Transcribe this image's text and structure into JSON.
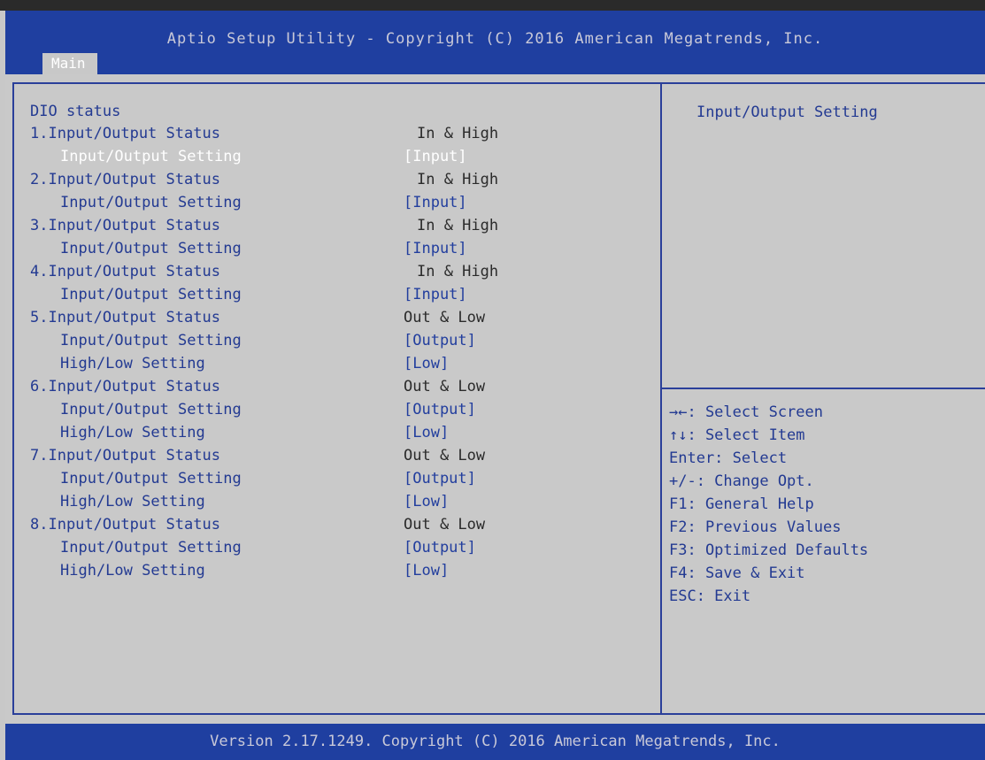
{
  "header": {
    "title": "Aptio Setup Utility - Copyright (C) 2016 American Megatrends, Inc.",
    "tabs": [
      {
        "label": "Main"
      }
    ]
  },
  "main": {
    "section_title": "DIO status",
    "rows": [
      {
        "label": "1.Input/Output Status",
        "value": "In & High"
      },
      {
        "label": "Input/Output Setting",
        "value": "[Input]"
      },
      {
        "label": "2.Input/Output Status",
        "value": "In & High"
      },
      {
        "label": "Input/Output Setting",
        "value": "[Input]"
      },
      {
        "label": "3.Input/Output Status",
        "value": "In & High"
      },
      {
        "label": "Input/Output Setting",
        "value": "[Input]"
      },
      {
        "label": "4.Input/Output Status",
        "value": "In & High"
      },
      {
        "label": "Input/Output Setting",
        "value": "[Input]"
      },
      {
        "label": "5.Input/Output Status",
        "value": "Out & Low"
      },
      {
        "label": "Input/Output Setting",
        "value": "[Output]"
      },
      {
        "label": "High/Low Setting",
        "value": "[Low]"
      },
      {
        "label": "6.Input/Output Status",
        "value": "Out & Low"
      },
      {
        "label": "Input/Output Setting",
        "value": "[Output]"
      },
      {
        "label": "High/Low Setting",
        "value": "[Low]"
      },
      {
        "label": "7.Input/Output Status",
        "value": "Out & Low"
      },
      {
        "label": "Input/Output Setting",
        "value": "[Output]"
      },
      {
        "label": "High/Low Setting",
        "value": "[Low]"
      },
      {
        "label": "8.Input/Output Status",
        "value": "Out & Low"
      },
      {
        "label": "Input/Output Setting",
        "value": "[Output]"
      },
      {
        "label": "High/Low Setting",
        "value": "[Low]"
      }
    ]
  },
  "help": {
    "title": "Input/Output Setting",
    "hints": [
      "→←: Select Screen",
      "↑↓: Select Item",
      "Enter: Select",
      "+/-: Change Opt.",
      "F1: General Help",
      "F2: Previous Values",
      "F3: Optimized Defaults",
      "F4: Save & Exit",
      "ESC: Exit"
    ]
  },
  "footer": {
    "text": "Version 2.17.1249. Copyright (C) 2016 American Megatrends, Inc."
  },
  "colors": {
    "header_bg": "#1f3fa0",
    "panel_bg": "#c9c9c9",
    "label_text": "#233a92",
    "highlight_text": "#ffffff"
  }
}
